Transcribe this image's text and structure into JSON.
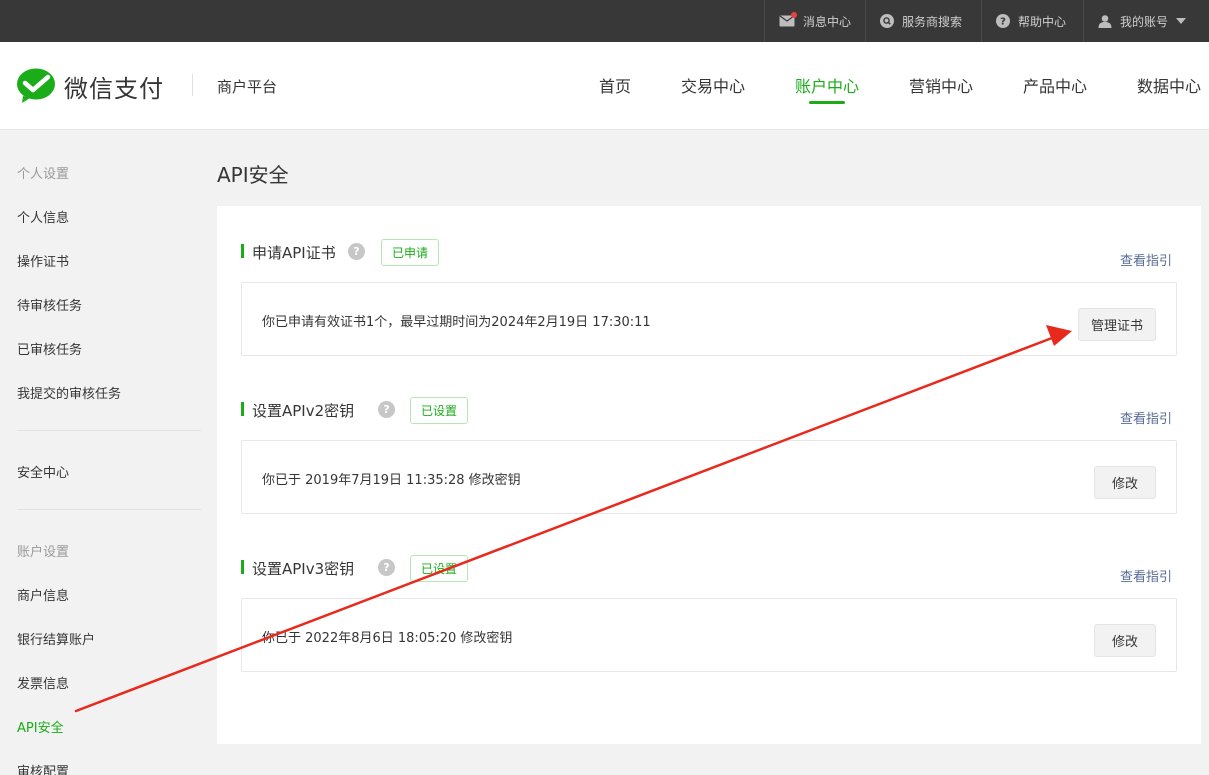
{
  "topbar": {
    "items": [
      {
        "label": "消息中心",
        "icon": "mail-icon"
      },
      {
        "label": "服务商搜索",
        "icon": "search-icon"
      },
      {
        "label": "帮助中心",
        "icon": "question-icon"
      },
      {
        "label": "我的账号",
        "icon": "user-icon"
      }
    ]
  },
  "header": {
    "brand": "微信支付",
    "platform": "商户平台",
    "nav": [
      "首页",
      "交易中心",
      "账户中心",
      "营销中心",
      "产品中心",
      "数据中心"
    ],
    "active_nav": "账户中心"
  },
  "sidebar": {
    "group1_title": "个人设置",
    "group1_items": [
      "个人信息",
      "操作证书",
      "待审核任务",
      "已审核任务",
      "我提交的审核任务"
    ],
    "security": "安全中心",
    "group2_title": "账户设置",
    "group2_items": [
      "商户信息",
      "银行结算账户",
      "发票信息",
      "API安全",
      "审核配置"
    ],
    "active_item": "API安全"
  },
  "main": {
    "title": "API安全",
    "sections": [
      {
        "title": "申请API证书",
        "status": "已申请",
        "guide": "查看指引",
        "text": "你已申请有效证书1个，最早过期时间为2024年2月19日 17:30:11",
        "button": "管理证书"
      },
      {
        "title": "设置APIv2密钥",
        "status": "已设置",
        "guide": "查看指引",
        "text": "你已于 2019年7月19日 11:35:28 修改密钥",
        "button": "修改"
      },
      {
        "title": "设置APIv3密钥",
        "status": "已设置",
        "guide": "查看指引",
        "text": "你已于 2022年8月6日 18:05:20 修改密钥",
        "button": "修改"
      }
    ]
  },
  "colors": {
    "accent": "#1aad19",
    "topbar": "#383838",
    "link": "#576b95",
    "annotation_arrow": "#e8291c"
  }
}
